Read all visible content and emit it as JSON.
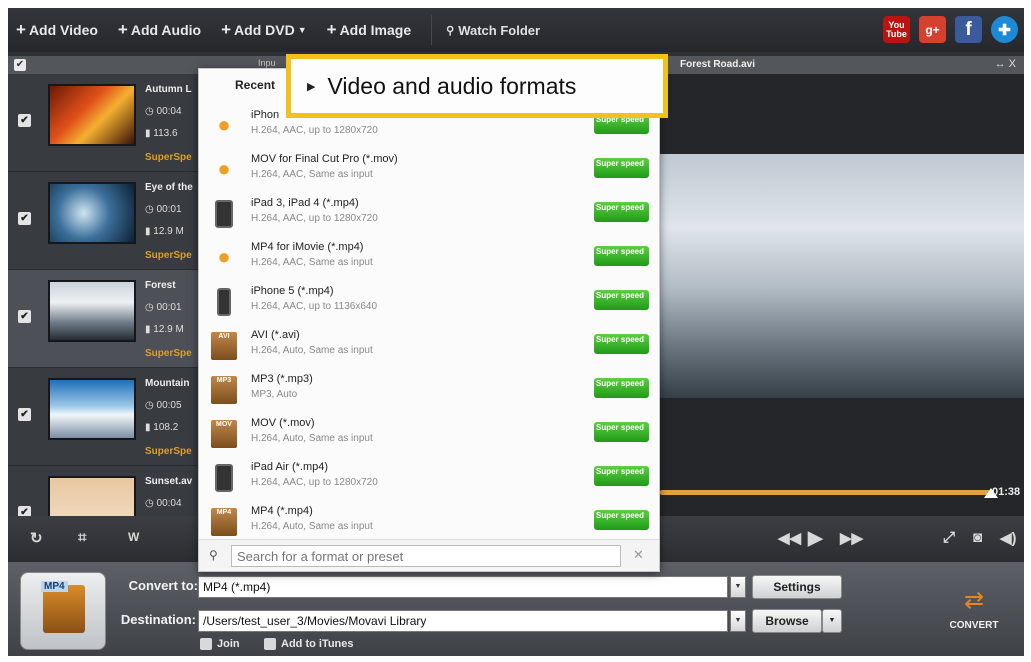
{
  "toolbar": {
    "add_video": "Add Video",
    "add_audio": "Add Audio",
    "add_dvd": "Add DVD",
    "add_image": "Add Image",
    "watch_folder": "Watch Folder",
    "social": {
      "youtube": "You Tube",
      "google_plus": "g+",
      "facebook": "f",
      "movavi": "✚"
    }
  },
  "list_header": {
    "input_label": "Inpu"
  },
  "files": [
    {
      "name": "Autumn L",
      "duration": "00:04",
      "size": "113.6",
      "badge": "SuperSpe"
    },
    {
      "name": "Eye of the",
      "duration": "00:01",
      "size": "12.9 M",
      "badge": "SuperSpe"
    },
    {
      "name": "Forest",
      "duration": "00:01",
      "size": "12.9 M",
      "badge": "SuperSpe"
    },
    {
      "name": "Mountain",
      "duration": "00:05",
      "size": "108.2",
      "badge": "SuperSpe"
    },
    {
      "name": "Sunset.av",
      "duration": "00:04",
      "size": "",
      "badge": ""
    }
  ],
  "preview": {
    "filename": "Forest Road.avi",
    "window_controls": "↔ X",
    "time": "01:38"
  },
  "popup": {
    "recent_tab": "Recent",
    "speed_badge": "Super speed",
    "items": [
      {
        "title": "iPhon",
        "sub": "H.264, AAC, up to 1280x720",
        "icon": "apple-icon"
      },
      {
        "title": "MOV for Final Cut Pro (*.mov)",
        "sub": "H.264, AAC, Same as input",
        "icon": "apple-icon"
      },
      {
        "title": "iPad 3, iPad 4 (*.mp4)",
        "sub": "H.264, AAC, up to 1280x720",
        "icon": "ipad-icon"
      },
      {
        "title": "MP4 for iMovie (*.mp4)",
        "sub": "H.264, AAC, Same as input",
        "icon": "apple-icon"
      },
      {
        "title": "iPhone 5 (*.mp4)",
        "sub": "H.264, AAC, up to 1136x640",
        "icon": "iphone-icon"
      },
      {
        "title": "AVI (*.avi)",
        "sub": "H.264, Auto, Same as input",
        "icon": "avi-file-icon"
      },
      {
        "title": "MP3 (*.mp3)",
        "sub": "MP3, Auto",
        "icon": "mp3-file-icon"
      },
      {
        "title": "MOV (*.mov)",
        "sub": "H.264, Auto, Same as input",
        "icon": "mov-file-icon"
      },
      {
        "title": "iPad Air (*.mp4)",
        "sub": "H.264, AAC, up to 1280x720",
        "icon": "ipad-icon"
      },
      {
        "title": "MP4 (*.mp4)",
        "sub": "H.264, Auto, Same as input",
        "icon": "mp4-file-icon"
      }
    ],
    "file_tags": {
      "avi": "AVI",
      "mp3": "MP3",
      "mov": "MOV",
      "mp4": "MP4"
    },
    "search_placeholder": "Search for a format or preset"
  },
  "callout": {
    "text": "Video and audio formats"
  },
  "bottom": {
    "format_icon_label": "MP4",
    "convert_to_label": "Convert to:",
    "convert_to_value": "MP4 (*.mp4)",
    "settings_button": "Settings",
    "destination_label": "Destination:",
    "destination_value": "/Users/test_user_3/Movies/Movavi Library",
    "browse_button": "Browse",
    "join_label": "Join",
    "itunes_label": "Add to iTunes",
    "convert_label": "CONVERT"
  },
  "colors": {
    "accent": "#e0a43a",
    "callout_border": "#f2c21a",
    "speed_green": "#2fae24"
  }
}
